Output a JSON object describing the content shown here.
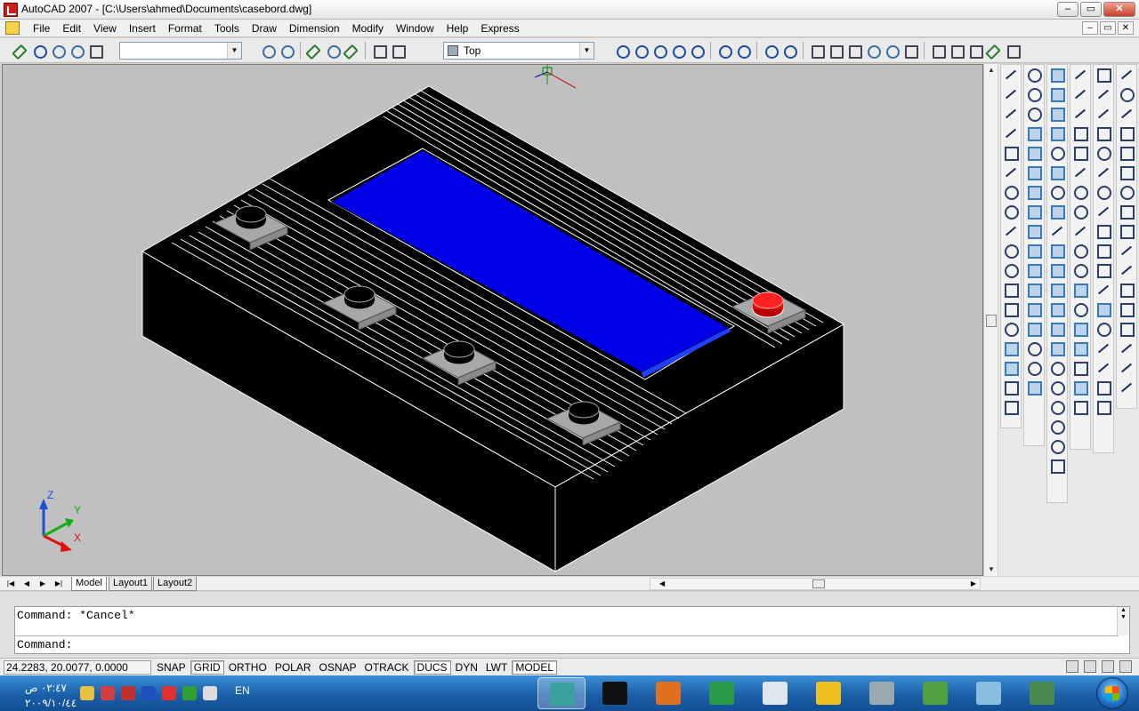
{
  "window": {
    "title": "AutoCAD 2007 - [C:\\Users\\ahmed\\Documents\\casebord.dwg]",
    "minimize": "–",
    "restore": "▭",
    "close": "✕"
  },
  "menu": {
    "items": [
      "File",
      "Edit",
      "View",
      "Insert",
      "Format",
      "Tools",
      "Draw",
      "Dimension",
      "Modify",
      "Window",
      "Help",
      "Express"
    ],
    "mdi_minimize": "–",
    "mdi_restore": "▭",
    "mdi_close": "✕"
  },
  "toolbar": {
    "layer_dropdown_value": "",
    "view_dropdown_value": "Top"
  },
  "drawing": {
    "background": "#c0c0c0",
    "display_color": "#0000e6",
    "button_red": "#e01010",
    "axis_labels": {
      "z": "Z",
      "y": "Y",
      "x": "X"
    }
  },
  "tabs": {
    "items": [
      "Model",
      "Layout1",
      "Layout2"
    ],
    "active": "Model"
  },
  "command": {
    "history": "Command: *Cancel*",
    "prompt": "Command:"
  },
  "status": {
    "coordinates": "24.2283, 20.0077, 0.0000",
    "toggles": [
      {
        "label": "SNAP",
        "on": false
      },
      {
        "label": "GRID",
        "on": true
      },
      {
        "label": "ORTHO",
        "on": false
      },
      {
        "label": "POLAR",
        "on": false
      },
      {
        "label": "OSNAP",
        "on": false
      },
      {
        "label": "OTRACK",
        "on": false
      },
      {
        "label": "DUCS",
        "on": true
      },
      {
        "label": "DYN",
        "on": false
      },
      {
        "label": "LWT",
        "on": false
      },
      {
        "label": "MODEL",
        "on": true
      }
    ]
  },
  "taskbar": {
    "time": "٠٢:٤٧ ص",
    "date": "٢٠٠٩/١٠/٤٤",
    "language": "EN"
  }
}
